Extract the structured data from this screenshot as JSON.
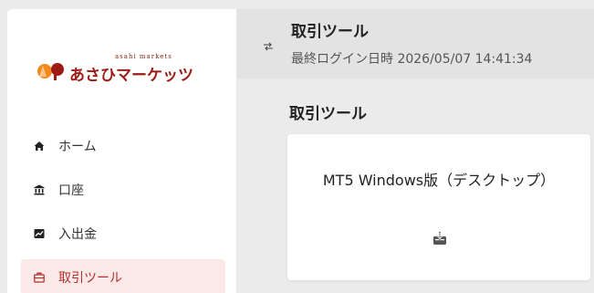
{
  "brand": {
    "small_text": "asahi markets",
    "big_text": "あさひマーケッツ",
    "colors": {
      "primary": "#9e1b14",
      "accent": "#f08a1c"
    }
  },
  "sidebar": {
    "items": [
      {
        "label": "ホーム",
        "icon": "home-icon",
        "active": false
      },
      {
        "label": "口座",
        "icon": "bank-icon",
        "active": false
      },
      {
        "label": "入出金",
        "icon": "chart-icon",
        "active": false
      },
      {
        "label": "取引ツール",
        "icon": "briefcase-icon",
        "active": true
      }
    ]
  },
  "header": {
    "title": "取引ツール",
    "last_login": "最終ログイン日時 2026/05/07 14:41:34",
    "toggle_icon": "swap-arrows-icon"
  },
  "main": {
    "section_title": "取引ツール",
    "cards": [
      {
        "title": "MT5 Windows版（デスクトップ）",
        "icon": "download-icon"
      }
    ]
  },
  "colors": {
    "active_bg": "#fbe9e9",
    "active_text": "#b5302a",
    "page_bg": "#ebebeb"
  }
}
